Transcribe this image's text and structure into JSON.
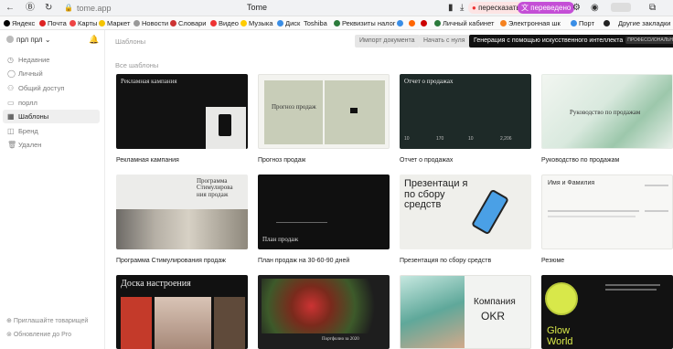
{
  "browser": {
    "url": "tome.app",
    "tab_title": "Tome",
    "ext_retell": "пересказать",
    "ext_translated": "переведено"
  },
  "bookmarks": [
    {
      "label": "Яндекс",
      "color": "#e33"
    },
    {
      "label": "Почта",
      "color": "#d22"
    },
    {
      "label": "Карты",
      "color": "#e44"
    },
    {
      "label": "Маркет",
      "color": "#f5c400"
    },
    {
      "label": "Новости",
      "color": "#999"
    },
    {
      "label": "Словари",
      "color": "#c33"
    },
    {
      "label": "Видео",
      "color": "#e33"
    },
    {
      "label": "Музыка",
      "color": "#fc0"
    },
    {
      "label": "Диск",
      "color": "#3a8ee6"
    },
    {
      "label": "Toshiba",
      "color": "#c00"
    },
    {
      "label": "Реквизиты налог",
      "color": "#2b7a3b"
    },
    {
      "label": "",
      "color": "#3a8ee6"
    },
    {
      "label": "",
      "color": "#f60"
    },
    {
      "label": "",
      "color": "#c00"
    },
    {
      "label": "Личный кабинет",
      "color": "#2b7a3b"
    },
    {
      "label": "Электронная шк",
      "color": "#f58220"
    },
    {
      "label": "Порт",
      "color": "#3a8ee6"
    },
    {
      "label": "",
      "color": "#222"
    },
    {
      "label": "Другие закладки",
      "color": "#aaa"
    }
  ],
  "sidebar": {
    "account": "прл прл",
    "items": [
      {
        "label": "Недавние",
        "icon": "clock"
      },
      {
        "label": "Личный",
        "icon": "user"
      },
      {
        "label": "Общий доступ",
        "icon": "users"
      },
      {
        "label": "порлл",
        "icon": "folder"
      },
      {
        "label": "Шаблоны",
        "icon": "grid",
        "active": true
      },
      {
        "label": "Бренд",
        "icon": "brand"
      },
      {
        "label": "Удален",
        "icon": "trash"
      }
    ],
    "invite": "Приглашайте товарищей",
    "upgrade": "Обновление до Pro"
  },
  "main": {
    "breadcrumb": "Шаблоны",
    "import_btn": "Импорт документа",
    "start_btn": "Начать с нуля",
    "ai_btn": "Генерация с помощью искусственного интеллекта",
    "ai_badge": "ПРОФЕССИОНАЛЬНЫЙ",
    "section": "Все шаблоны"
  },
  "templates": [
    {
      "caption": "Рекламная кампания",
      "title": "Рекламная кампания"
    },
    {
      "caption": "Прогноз продаж",
      "title": "Прогноз продаж"
    },
    {
      "caption": "Отчет о продажах",
      "title": "Отчет о продажах",
      "stats": [
        "10",
        "170",
        "10",
        "2,206"
      ]
    },
    {
      "caption": "Руководство по продажам",
      "title": "Руководство по продажам"
    },
    {
      "caption": "Программа Стимулирования продаж",
      "title": "Программа Стимулирова ния продаж"
    },
    {
      "caption": "План продаж на 30-60-90 дней",
      "title": "План продаж"
    },
    {
      "caption": "Презентация по сбору средств",
      "title": "Презентаци я по сбору средств"
    },
    {
      "caption": "Резюме",
      "title": "Имя и Фамилия"
    },
    {
      "caption": "",
      "title": "Доска настроения"
    },
    {
      "caption": "",
      "title": "Портфолио за 2020"
    },
    {
      "caption": "",
      "title": "Компания",
      "title2": "OKR"
    },
    {
      "caption": "",
      "title": "Glow",
      "title2": "World"
    }
  ]
}
